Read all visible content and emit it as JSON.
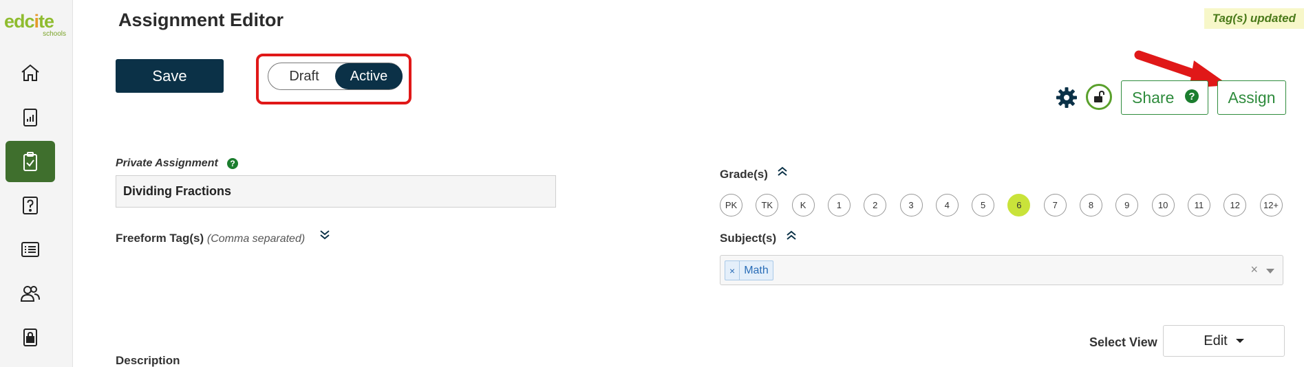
{
  "logo": {
    "name_part1": "edc",
    "name_o": "i",
    "name_part2": "te",
    "sub": "schools"
  },
  "sidebar": {
    "items": [
      {
        "icon": "home-icon"
      },
      {
        "icon": "report-icon"
      },
      {
        "icon": "clipboard-check-icon",
        "active": true
      },
      {
        "icon": "question-icon"
      },
      {
        "icon": "list-icon"
      },
      {
        "icon": "users-icon"
      },
      {
        "icon": "lock-icon"
      }
    ]
  },
  "header": {
    "title": "Assignment Editor",
    "toast": "Tag(s) updated",
    "save_label": "Save",
    "toggle": {
      "draft_label": "Draft",
      "active_label": "Active",
      "selected": "Active"
    },
    "share_label": "Share",
    "share_help": "?",
    "assign_label": "Assign"
  },
  "form": {
    "private_label": "Private Assignment",
    "private_help": "?",
    "name_value": "Dividing Fractions",
    "tags_label": "Freeform Tag(s)",
    "tags_hint": "(Comma separated)",
    "description_label": "Description",
    "grades_label": "Grade(s)",
    "grades": [
      "PK",
      "TK",
      "K",
      "1",
      "2",
      "3",
      "4",
      "5",
      "6",
      "7",
      "8",
      "9",
      "10",
      "11",
      "12",
      "12+"
    ],
    "selected_grade": "6",
    "subjects_label": "Subject(s)",
    "subjects": [
      {
        "remove": "×",
        "label": "Math"
      }
    ],
    "subjects_clear": "×",
    "select_view_label": "Select View",
    "view_value": "Edit"
  },
  "colors": {
    "navy": "#0b3147",
    "green": "#2e8b3c",
    "sidebar_active": "#3f6f2d",
    "grade_selected": "#c9e33a",
    "highlight": "#e01818"
  }
}
